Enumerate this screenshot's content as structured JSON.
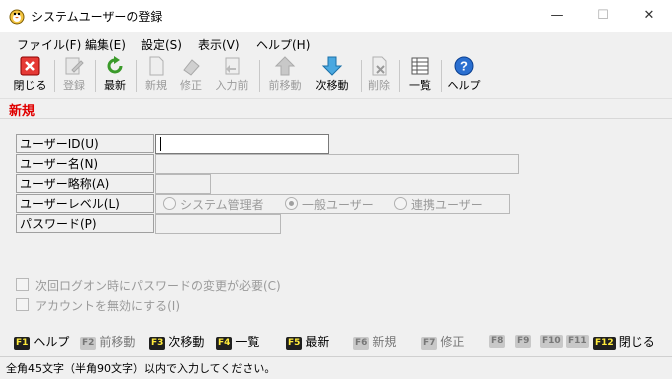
{
  "window": {
    "title": "システムユーザーの登録",
    "minimize": "—",
    "maximize": "☐",
    "close": "✕"
  },
  "menu": [
    "ファイル(F)",
    "編集(E)",
    "設定(S)",
    "表示(V)",
    "ヘルプ(H)"
  ],
  "toolbar": {
    "close": "閉じる",
    "register": "登録",
    "refresh": "最新",
    "new": "新規",
    "modify": "修正",
    "input_previous": "入力前",
    "prev": "前移動",
    "next": "次移動",
    "delete": "削除",
    "list": "一覧",
    "help": "ヘルプ"
  },
  "mode": "新規",
  "form": {
    "user_id_label": "ユーザーID(U)",
    "user_name_label": "ユーザー名(N)",
    "user_abbr_label": "ユーザー略称(A)",
    "user_level_label": "ユーザーレベル(L)",
    "password_label": "パスワード(P)",
    "user_id_value": "",
    "level_options": [
      "システム管理者",
      "一般ユーザー",
      "連携ユーザー"
    ],
    "level_selected": "一般ユーザー"
  },
  "checkboxes": {
    "require_password_change": "次回ログオン時にパスワードの変更が必要(C)",
    "disable_account": "アカウントを無効にする(I)"
  },
  "fkeys": [
    {
      "key": "F1",
      "label": "ヘルプ",
      "enabled": true
    },
    {
      "key": "F2",
      "label": "前移動",
      "enabled": false
    },
    {
      "key": "F3",
      "label": "次移動",
      "enabled": true
    },
    {
      "key": "F4",
      "label": "一覧",
      "enabled": true
    },
    {
      "key": "F5",
      "label": "最新",
      "enabled": true
    },
    {
      "key": "F6",
      "label": "新規",
      "enabled": false
    },
    {
      "key": "F7",
      "label": "修正",
      "enabled": false
    },
    {
      "key": "F8",
      "label": "",
      "enabled": false
    },
    {
      "key": "F9",
      "label": "",
      "enabled": false
    },
    {
      "key": "F10",
      "label": "",
      "enabled": false
    },
    {
      "key": "F11",
      "label": "",
      "enabled": false
    },
    {
      "key": "F12",
      "label": "閉じる",
      "enabled": true
    }
  ],
  "status": "全角45文字（半角90文字）以内で入力してください。",
  "colors": {
    "mode_label": "#e00000",
    "fkey_bg": "#202020",
    "fkey_text": "#ffeb3b"
  }
}
